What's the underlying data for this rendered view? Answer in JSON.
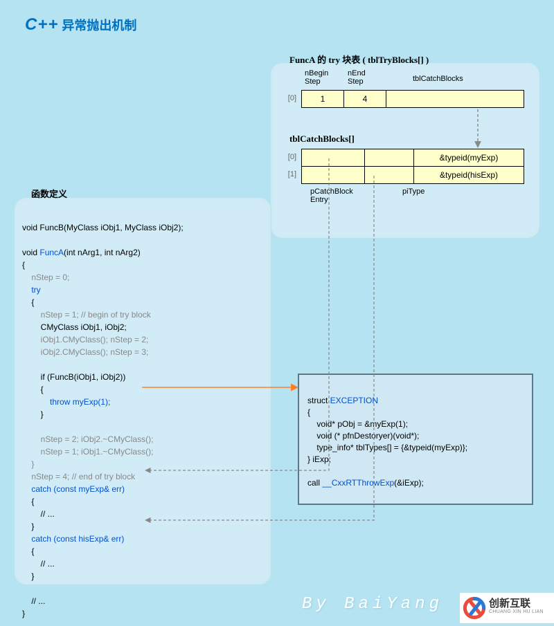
{
  "title": {
    "cpp": "C++",
    "rest": " 异常抛出机制"
  },
  "bubble_func_title": "函数定义",
  "bubble_try_title": "FuncA 的 try 块表 ( tblTryBlocks[] )",
  "tryblocks": {
    "headers": {
      "nBegin": "nBegin\nStep",
      "nEnd": "nEnd\nStep",
      "catch": "tblCatchBlocks"
    },
    "rows": [
      {
        "idx": "[0]",
        "nBegin": "1",
        "nEnd": "4",
        "catch": ""
      }
    ]
  },
  "catchblocks": {
    "title": "tblCatchBlocks[]",
    "rows": [
      {
        "idx": "[0]",
        "c0": "",
        "c1": "",
        "c2": "&typeid(myExp)"
      },
      {
        "idx": "[1]",
        "c0": "",
        "c1": "",
        "c2": "&typeid(hisExp)"
      }
    ],
    "labels": {
      "pCatch": "pCatchBlock\nEntry",
      "piType": "piType"
    }
  },
  "code": {
    "l01": "void FuncB(MyClass iObj1, MyClass iObj2);",
    "l02": "",
    "l03_a": "void ",
    "l03_b": "FuncA",
    "l03_c": "(int nArg1, int nArg2)",
    "l04": "{",
    "l05": "    nStep = 0;",
    "l06": "    try",
    "l07": "    {",
    "l08": "        nStep = 1; // begin of try block",
    "l09": "        CMyClass iObj1, iObj2;",
    "l10": "        iObj1.CMyClass(); nStep = 2;",
    "l11": "        iObj2.CMyClass(); nStep = 3;",
    "l12": "",
    "l13": "        if (FuncB(iObj1, iObj2))",
    "l14": "        {",
    "l15_a": "            ",
    "l15_b": "throw myExp(1);",
    "l16": "        }",
    "l17": "",
    "l18": "        nStep = 2; iObj2.~CMyClass();",
    "l19": "        nStep = 1; iObj1.~CMyClass();",
    "l20": "    }",
    "l21": "    nStep = 4; // end of try block",
    "l22": "    catch (const myExp& err)",
    "l23": "    {",
    "l24": "        // ...",
    "l25": "    }",
    "l26": "    catch (const hisExp& err)",
    "l27": "    {",
    "l28": "        // ...",
    "l29": "    }",
    "l30": "",
    "l31": "    // ...",
    "l32": "}"
  },
  "excbox": {
    "l1_a": "struct ",
    "l1_b": "EXCEPTION",
    "l2": "{",
    "l3": "    void* pObj = &myExp(1);",
    "l4": "    void (* pfnDestoryer)(void*);",
    "l5": "    type_info* tblTypes[] = {&typeid(myExp)};",
    "l6": "} iExp;",
    "l7": "",
    "l8_a": "call ",
    "l8_b": "__CxxRTThrowExp",
    "l8_c": "(&iExp);"
  },
  "footer": "By BaiYang",
  "logo": {
    "line1": "创新互联",
    "line2": "CHUANG XIN HU LIAN"
  }
}
